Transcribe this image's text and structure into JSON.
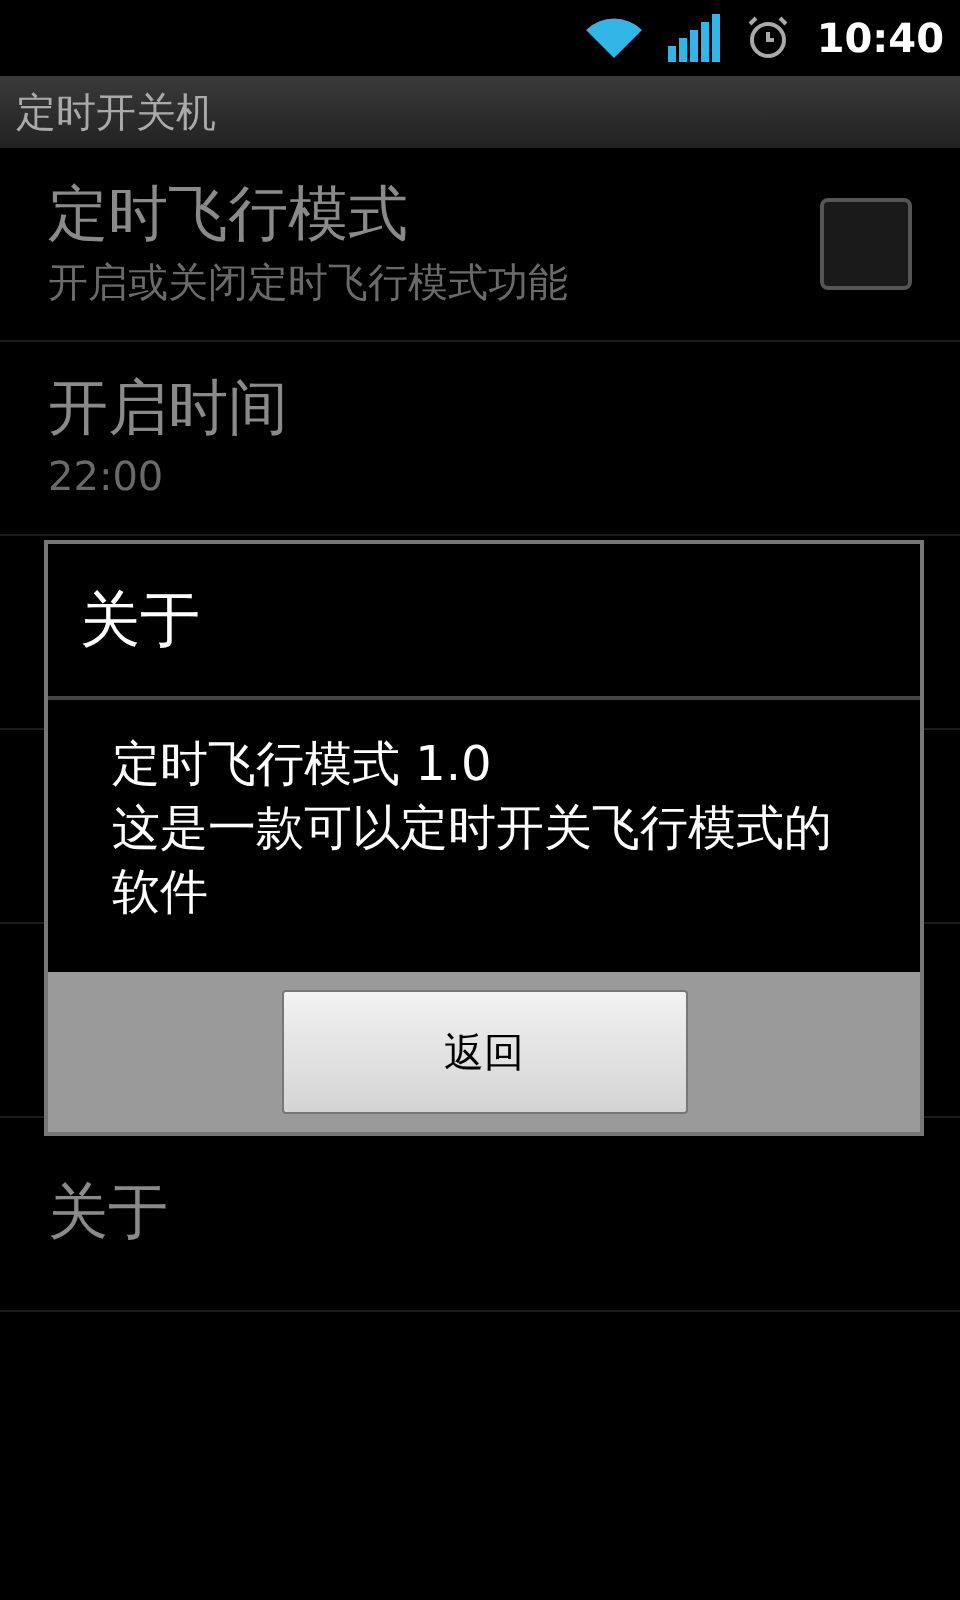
{
  "status_bar": {
    "time": "10:40"
  },
  "app_bar": {
    "title": "定时开关机"
  },
  "settings": [
    {
      "kind": "checkbox",
      "title": "定时飞行模式",
      "summary": "开启或关闭定时飞行模式功能",
      "checked": false
    },
    {
      "kind": "text",
      "title": "开启时间",
      "summary": "22:00"
    },
    {
      "kind": "hidden"
    },
    {
      "kind": "hidden"
    },
    {
      "kind": "hidden"
    },
    {
      "kind": "text",
      "title": "关于"
    }
  ],
  "dialog": {
    "title": "关于",
    "lines": [
      "定时飞行模式 1.0",
      "这是一款可以定时开关飞行模式的软件"
    ],
    "button": "返回"
  }
}
